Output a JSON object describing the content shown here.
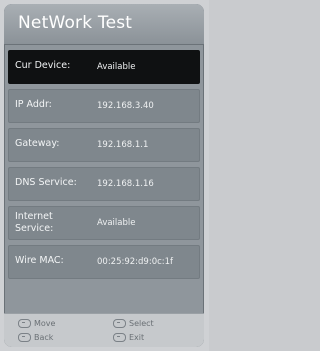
{
  "title": "NetWork Test",
  "rows": [
    {
      "label": "Cur Device:",
      "value": "Available"
    },
    {
      "label": "IP Addr:",
      "value": "192.168.3.40"
    },
    {
      "label": "Gateway:",
      "value": "192.168.1.1"
    },
    {
      "label": "DNS Service:",
      "value": "192.168.1.16"
    },
    {
      "label": "Internet Service:",
      "value": "Available"
    },
    {
      "label": "Wire MAC:",
      "value": "00:25:92:d9:0c:1f"
    }
  ],
  "footer": {
    "move": "Move",
    "select": "Select",
    "back": "Back",
    "exit": "Exit"
  },
  "colors": {
    "panel": "#8f969c",
    "selected_row": "#0f1112",
    "footer": "#c6c9cc"
  }
}
